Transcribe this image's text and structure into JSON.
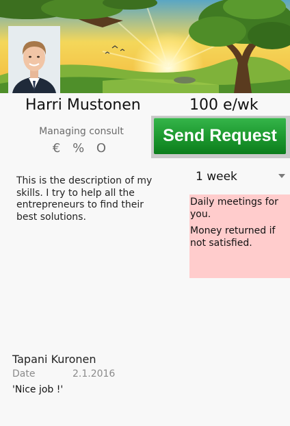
{
  "profile": {
    "name": "Harri Mustonen",
    "price": "100 e/wk",
    "role": "Managing consult",
    "symbols": "€ % O",
    "description": "This is the description of my skills. I try to help all the entrepreneurs to find their best solutions."
  },
  "actions": {
    "send_request_label": "Send Request"
  },
  "duration": {
    "selected": "1 week"
  },
  "terms": [
    "Daily meetings for you.",
    "Money returned if not satisfied."
  ],
  "review": {
    "reviewer": "Tapani Kuronen",
    "date_label": "Date",
    "date_value": "2.1.2016",
    "comment": "'Nice job !'"
  },
  "colors": {
    "send_button": "#1e9a30",
    "terms_background": "#ffcccc",
    "page_background": "#f8f8f8"
  },
  "icons": {
    "dropdown": "triangle-down"
  }
}
